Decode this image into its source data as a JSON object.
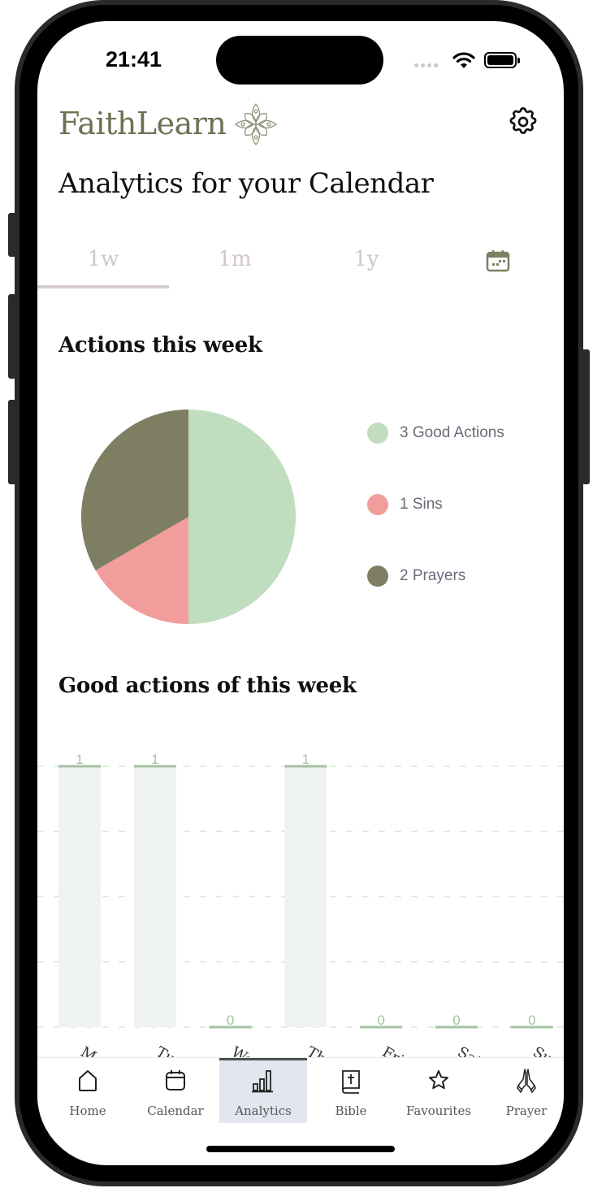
{
  "status_bar": {
    "time": "21:41"
  },
  "header": {
    "app_name": "FaithLearn",
    "page_title": "Analytics for your Calendar"
  },
  "icons": {
    "brand": "ornament-icon",
    "settings": "gear-icon",
    "custom_range": "calendar-icon"
  },
  "tabs": [
    {
      "label": "1w",
      "selected": true
    },
    {
      "label": "1m",
      "selected": false
    },
    {
      "label": "1y",
      "selected": false
    }
  ],
  "colors": {
    "brand": "#6e7152",
    "good_actions": "#c1ddbf",
    "sins": "#f09d9b",
    "prayers": "#7e7e62",
    "bar_fill": "#eff3ef",
    "bar_cap": "#a5c2a2"
  },
  "sections": {
    "pie_title": "Actions this week",
    "bar_title": "Good actions of this week"
  },
  "chart_data": [
    {
      "type": "pie",
      "title": "Actions this week",
      "slices": [
        {
          "label": "Good Actions",
          "value": 3,
          "color": "#c1ddbf",
          "legend": "3 Good Actions"
        },
        {
          "label": "Sins",
          "value": 1,
          "color": "#f09d9b",
          "legend": "1 Sins"
        },
        {
          "label": "Prayers",
          "value": 2,
          "color": "#7e7e62",
          "legend": "2 Prayers"
        }
      ],
      "legend_position": "right"
    },
    {
      "type": "bar",
      "title": "Good actions of this week",
      "categories": [
        "Monday",
        "Tuesday",
        "Wednesday",
        "Thursday",
        "Friday",
        "Saturday",
        "Sunday"
      ],
      "tick_labels_visible": [
        "Monda",
        "Tuesda",
        "Wedne",
        "Thursd",
        "Friday",
        "Saturd",
        "Sund"
      ],
      "values": [
        1,
        1,
        0,
        1,
        0,
        0,
        0
      ],
      "ylim": [
        0,
        1
      ],
      "grid": true,
      "data_labels": true
    }
  ],
  "bottom_nav": [
    {
      "label": "Home",
      "icon": "home-icon",
      "active": false
    },
    {
      "label": "Calendar",
      "icon": "calendar-icon",
      "active": false
    },
    {
      "label": "Analytics",
      "icon": "bar-chart-icon",
      "active": true
    },
    {
      "label": "Bible",
      "icon": "bible-icon",
      "active": false
    },
    {
      "label": "Favourites",
      "icon": "star-icon",
      "active": false
    },
    {
      "label": "Prayer",
      "icon": "praying-hands-icon",
      "active": false
    }
  ]
}
